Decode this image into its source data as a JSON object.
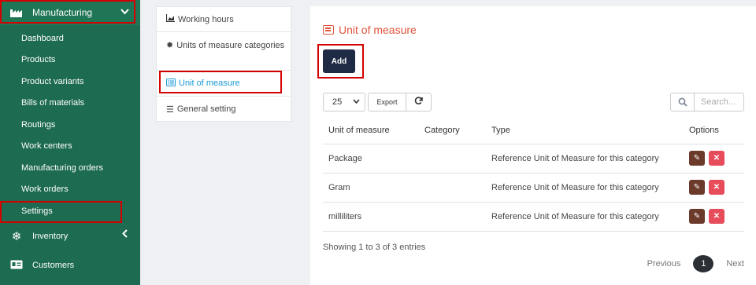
{
  "sidebar": {
    "module": "Manufacturing",
    "items": [
      {
        "label": "Dashboard"
      },
      {
        "label": "Products"
      },
      {
        "label": "Product variants"
      },
      {
        "label": "Bills of materials"
      },
      {
        "label": "Routings"
      },
      {
        "label": "Work centers"
      },
      {
        "label": "Manufacturing orders"
      },
      {
        "label": "Work orders"
      },
      {
        "label": "Settings"
      }
    ],
    "sections": [
      {
        "label": "Inventory",
        "icon": "snowflake-icon"
      },
      {
        "label": "Customers",
        "icon": "id-card-icon"
      }
    ],
    "colors": {
      "bg": "#1d6b50",
      "highlight": "#d40000"
    }
  },
  "settings_nav": [
    {
      "label": "Working hours",
      "icon": "chart-icon"
    },
    {
      "label": "Units of measure categories",
      "icon": "gear-icon"
    },
    {
      "label": "Unit of measure",
      "icon": "list-icon",
      "active": true
    },
    {
      "label": "General setting",
      "icon": "menu-icon"
    }
  ],
  "main": {
    "title": "Unit of measure",
    "add_label": "Add",
    "page_size": "25",
    "export_label": "Export",
    "search_placeholder": "Search...",
    "columns": [
      "Unit of measure",
      "Category",
      "Type",
      "Options"
    ],
    "rows": [
      {
        "unit": "Package",
        "category": "",
        "type": "Reference Unit of Measure for this category"
      },
      {
        "unit": "Gram",
        "category": "",
        "type": "Reference Unit of Measure for this category"
      },
      {
        "unit": "milliliters",
        "category": "",
        "type": "Reference Unit of Measure for this category"
      }
    ],
    "info": "Showing 1 to 3 of 3 entries",
    "pagination": {
      "previous": "Previous",
      "current": "1",
      "next": "Next"
    },
    "colors": {
      "title": "#e0533b",
      "add": "#1f2a44",
      "edit": "#6b3a2a",
      "delete": "#e74c5b"
    }
  }
}
